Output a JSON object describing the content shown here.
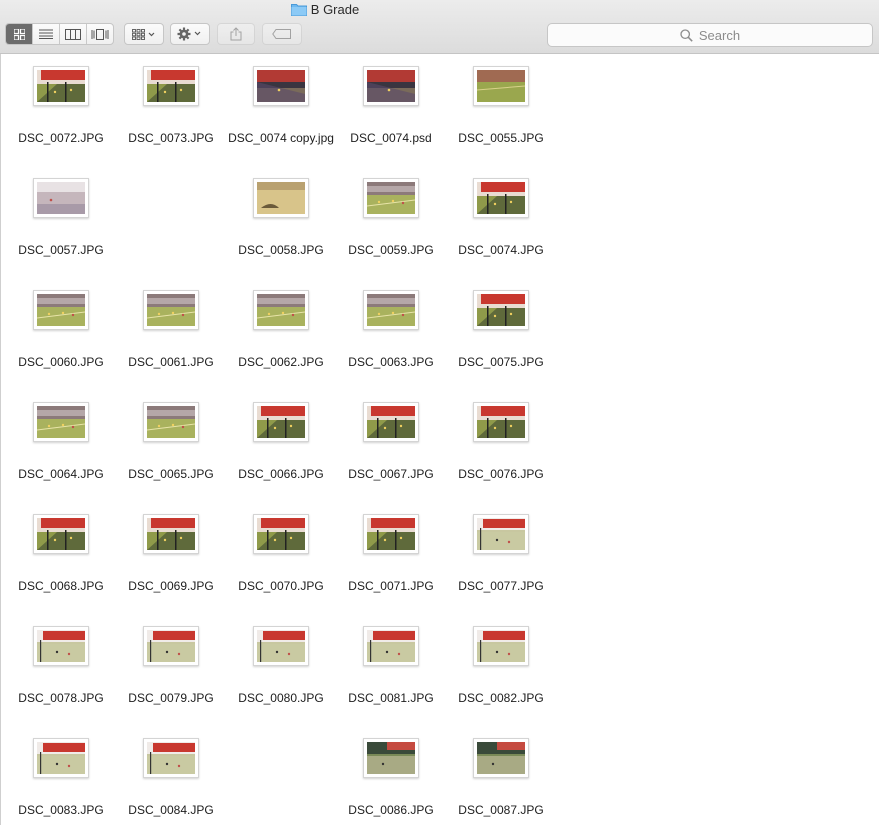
{
  "window": {
    "title": "B Grade"
  },
  "toolbar": {
    "views": [
      {
        "icon": "icon-view-icon",
        "active": true
      },
      {
        "icon": "list-view-icon",
        "active": false
      },
      {
        "icon": "column-view-icon",
        "active": false
      },
      {
        "icon": "cover-flow-view-icon",
        "active": false
      }
    ],
    "search_placeholder": "Search"
  },
  "colors": {
    "red_building": "#c8382f",
    "grass": "#8f9a4a",
    "dark_grass": "#3f4a2c",
    "sand": "#d8c48a"
  },
  "files": [
    {
      "name": "DSC_0072.JPG",
      "thumb": "red"
    },
    {
      "name": "DSC_0073.JPG",
      "thumb": "red"
    },
    {
      "name": "DSC_0074 copy.jpg",
      "thumb": "dark"
    },
    {
      "name": "DSC_0074.psd",
      "thumb": "dark"
    },
    {
      "name": "DSC_0055.JPG",
      "thumb": "field"
    },
    {
      "name": "DSC_0057.JPG",
      "thumb": "white"
    },
    {
      "name": "",
      "thumb": "none"
    },
    {
      "name": "DSC_0058.JPG",
      "thumb": "sand"
    },
    {
      "name": "DSC_0059.JPG",
      "thumb": "crowd"
    },
    {
      "name": "DSC_0074.JPG",
      "thumb": "red"
    },
    {
      "name": "DSC_0060.JPG",
      "thumb": "crowd"
    },
    {
      "name": "DSC_0061.JPG",
      "thumb": "crowd"
    },
    {
      "name": "DSC_0062.JPG",
      "thumb": "crowd"
    },
    {
      "name": "DSC_0063.JPG",
      "thumb": "crowd"
    },
    {
      "name": "DSC_0075.JPG",
      "thumb": "red"
    },
    {
      "name": "DSC_0064.JPG",
      "thumb": "crowd"
    },
    {
      "name": "DSC_0065.JPG",
      "thumb": "crowd"
    },
    {
      "name": "DSC_0066.JPG",
      "thumb": "red"
    },
    {
      "name": "DSC_0067.JPG",
      "thumb": "red"
    },
    {
      "name": "DSC_0076.JPG",
      "thumb": "red"
    },
    {
      "name": "DSC_0068.JPG",
      "thumb": "red"
    },
    {
      "name": "DSC_0069.JPG",
      "thumb": "red"
    },
    {
      "name": "DSC_0070.JPG",
      "thumb": "red"
    },
    {
      "name": "DSC_0071.JPG",
      "thumb": "red"
    },
    {
      "name": "DSC_0077.JPG",
      "thumb": "pale"
    },
    {
      "name": "DSC_0078.JPG",
      "thumb": "pale"
    },
    {
      "name": "DSC_0079.JPG",
      "thumb": "pale"
    },
    {
      "name": "DSC_0080.JPG",
      "thumb": "pale"
    },
    {
      "name": "DSC_0081.JPG",
      "thumb": "pale"
    },
    {
      "name": "DSC_0082.JPG",
      "thumb": "pale"
    },
    {
      "name": "DSC_0083.JPG",
      "thumb": "pale"
    },
    {
      "name": "DSC_0084.JPG",
      "thumb": "pale"
    },
    {
      "name": "",
      "thumb": "none"
    },
    {
      "name": "DSC_0086.JPG",
      "thumb": "green"
    },
    {
      "name": "DSC_0087.JPG",
      "thumb": "green"
    }
  ]
}
